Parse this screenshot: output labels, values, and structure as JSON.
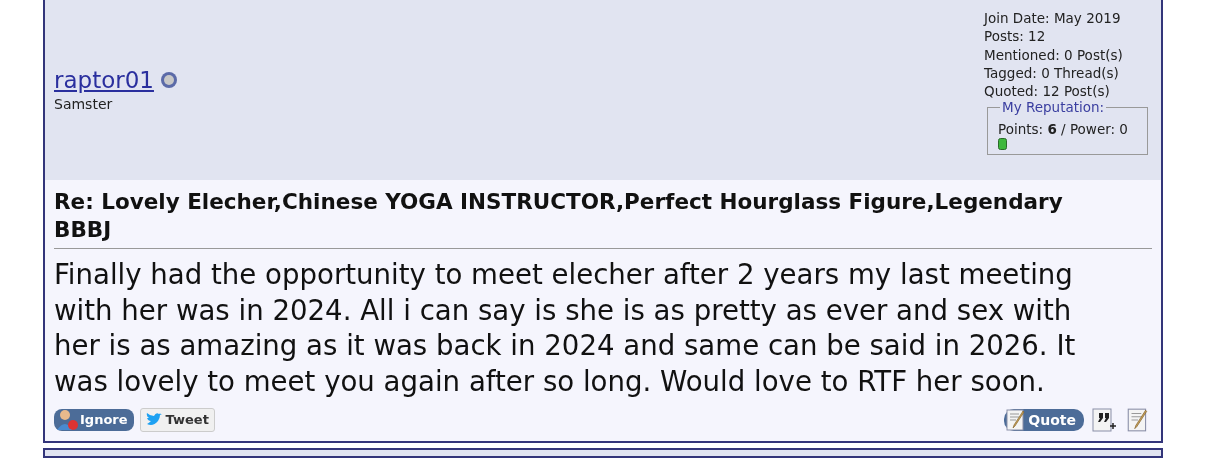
{
  "user": {
    "name": "raptor01",
    "online": false,
    "title": "Samster"
  },
  "stats": [
    "Join Date: May 2019",
    "Posts: 12",
    "Mentioned: 0 Post(s)",
    "Tagged: 0 Thread(s)",
    "Quoted: 12 Post(s)"
  ],
  "reputation": {
    "legend": "My Reputation:",
    "points_label": "Points: ",
    "points": "6",
    "power": " / Power: 0"
  },
  "post": {
    "title": "Re: Lovely Elecher,Chinese YOGA INSTRUCTOR,Perfect Hourglass Figure,Legendary BBBJ",
    "body": "Finally had the opportunity to meet elecher after 2 years my last meeting with her was in 2024. All i can say is she is as pretty as ever and sex with her is as amazing as it was back in 2024 and same can be said in 2026. It was lovely to meet you again after so long. Would love to RTF her soon."
  },
  "left_buttons": [
    {
      "kind": "ignore",
      "label": "Ignore"
    },
    {
      "kind": "tweet",
      "label": "Tweet"
    }
  ],
  "right_buttons": [
    {
      "kind": "quote",
      "label": "Quote"
    },
    {
      "kind": "multiquote"
    },
    {
      "kind": "reply"
    }
  ]
}
